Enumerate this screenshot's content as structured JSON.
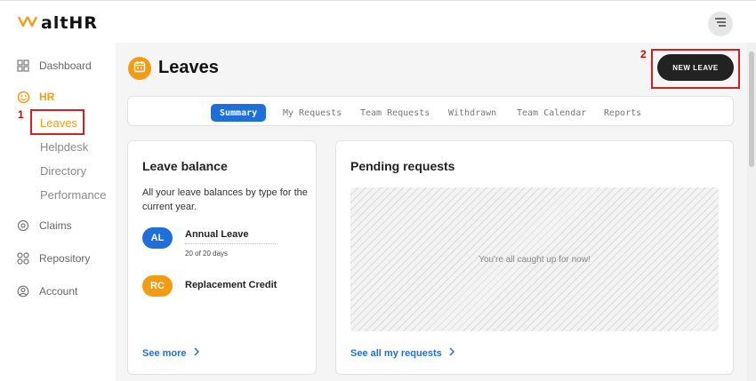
{
  "app": {
    "logo_text": "altHR",
    "brand_color": "#f39c12",
    "accent_color": "#1e6fd9"
  },
  "sidebar": {
    "dashboard": "Dashboard",
    "hr": "HR",
    "hr_items": [
      "Leaves",
      "Helpdesk",
      "Directory",
      "Performance"
    ],
    "claims": "Claims",
    "repository": "Repository",
    "account": "Account"
  },
  "annotations": {
    "marker_1": "1",
    "marker_2": "2"
  },
  "page": {
    "title": "Leaves",
    "new_leave_button": "NEW LEAVE"
  },
  "tabs": [
    "Summary",
    "My Requests",
    "Team Requests",
    "Withdrawn",
    "Team Calendar",
    "Reports"
  ],
  "leave_balance": {
    "title": "Leave balance",
    "description": "All your leave balances by type for the current year.",
    "items": [
      {
        "badge": "AL",
        "name": "Annual Leave",
        "count": "20 of 20 days",
        "color": "#1e6fd9"
      },
      {
        "badge": "RC",
        "name": "Replacement Credit",
        "color": "#f39c12"
      }
    ],
    "see_more": "See more"
  },
  "pending_requests": {
    "title": "Pending requests",
    "empty_text": "You're all caught up for now!",
    "see_all": "See all my requests"
  }
}
